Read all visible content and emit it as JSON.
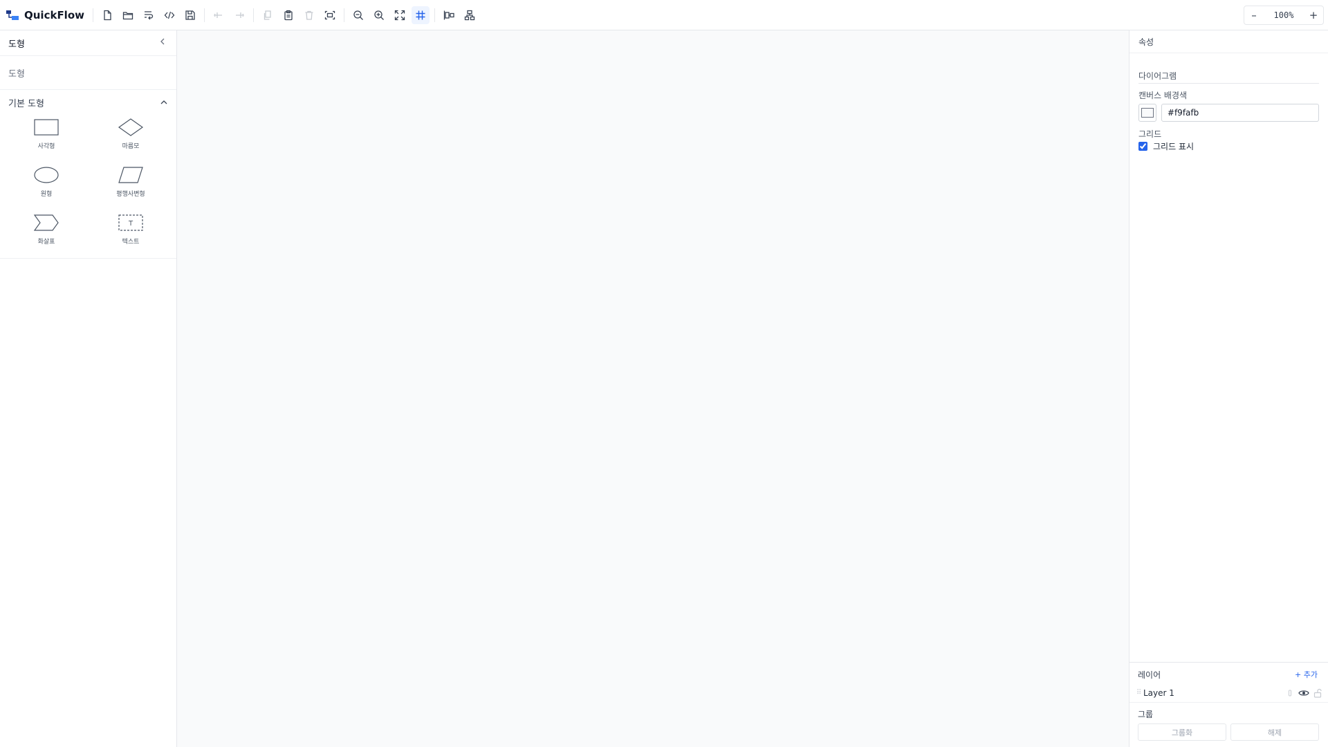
{
  "app": {
    "title": "QuickFlow"
  },
  "toolbar": {
    "buttons": [
      {
        "icon": "new-file-icon",
        "state": "enabled"
      },
      {
        "icon": "open-folder-icon",
        "state": "enabled"
      },
      {
        "icon": "import-icon",
        "state": "enabled"
      },
      {
        "icon": "code-icon",
        "state": "enabled"
      },
      {
        "icon": "save-icon",
        "state": "enabled"
      },
      {
        "icon": "undo-icon",
        "state": "disabled"
      },
      {
        "icon": "redo-icon",
        "state": "disabled"
      },
      {
        "icon": "copy-icon",
        "state": "disabled"
      },
      {
        "icon": "paste-icon",
        "state": "enabled"
      },
      {
        "icon": "delete-icon",
        "state": "disabled"
      },
      {
        "icon": "select-all-icon",
        "state": "enabled"
      },
      {
        "icon": "zoom-out-icon",
        "state": "enabled"
      },
      {
        "icon": "zoom-in-icon",
        "state": "enabled"
      },
      {
        "icon": "fit-screen-icon",
        "state": "enabled"
      },
      {
        "icon": "grid-icon",
        "state": "active"
      },
      {
        "icon": "align-icon",
        "state": "enabled"
      },
      {
        "icon": "auto-layout-icon",
        "state": "enabled"
      }
    ],
    "zoom": {
      "minus": "–",
      "value": "100%",
      "plus": "+"
    }
  },
  "left_panel": {
    "title": "도형",
    "search_placeholder": "도형",
    "category": "기본 도형",
    "shapes": [
      {
        "icon": "rectangle-icon",
        "label": "사각형"
      },
      {
        "icon": "diamond-icon",
        "label": "마름모"
      },
      {
        "icon": "ellipse-icon",
        "label": "원형"
      },
      {
        "icon": "parallelogram-icon",
        "label": "평행사변형"
      },
      {
        "icon": "arrow-shape-icon",
        "label": "화살표"
      },
      {
        "icon": "text-shape-icon",
        "label": "텍스트"
      }
    ]
  },
  "canvas": {
    "background": "#f9fafb"
  },
  "right_panel": {
    "title": "속성",
    "section": "다이어그램",
    "bg_label": "캔버스 배경색",
    "bg_value": "#f9fafb",
    "grid_label": "그리드",
    "grid_checkbox_label": "그리드 표시",
    "grid_checked": true,
    "layers": {
      "title": "레이어",
      "add_label": "+ 추가",
      "items": [
        {
          "name": "Layer 1",
          "visible": true,
          "locked": false
        }
      ]
    },
    "group": {
      "title": "그룹",
      "group_label": "그룹화",
      "ungroup_label": "해제"
    }
  },
  "colors": {
    "accent": "#2563eb",
    "border": "#e5e7eb",
    "canvas": "#f9fafb"
  }
}
